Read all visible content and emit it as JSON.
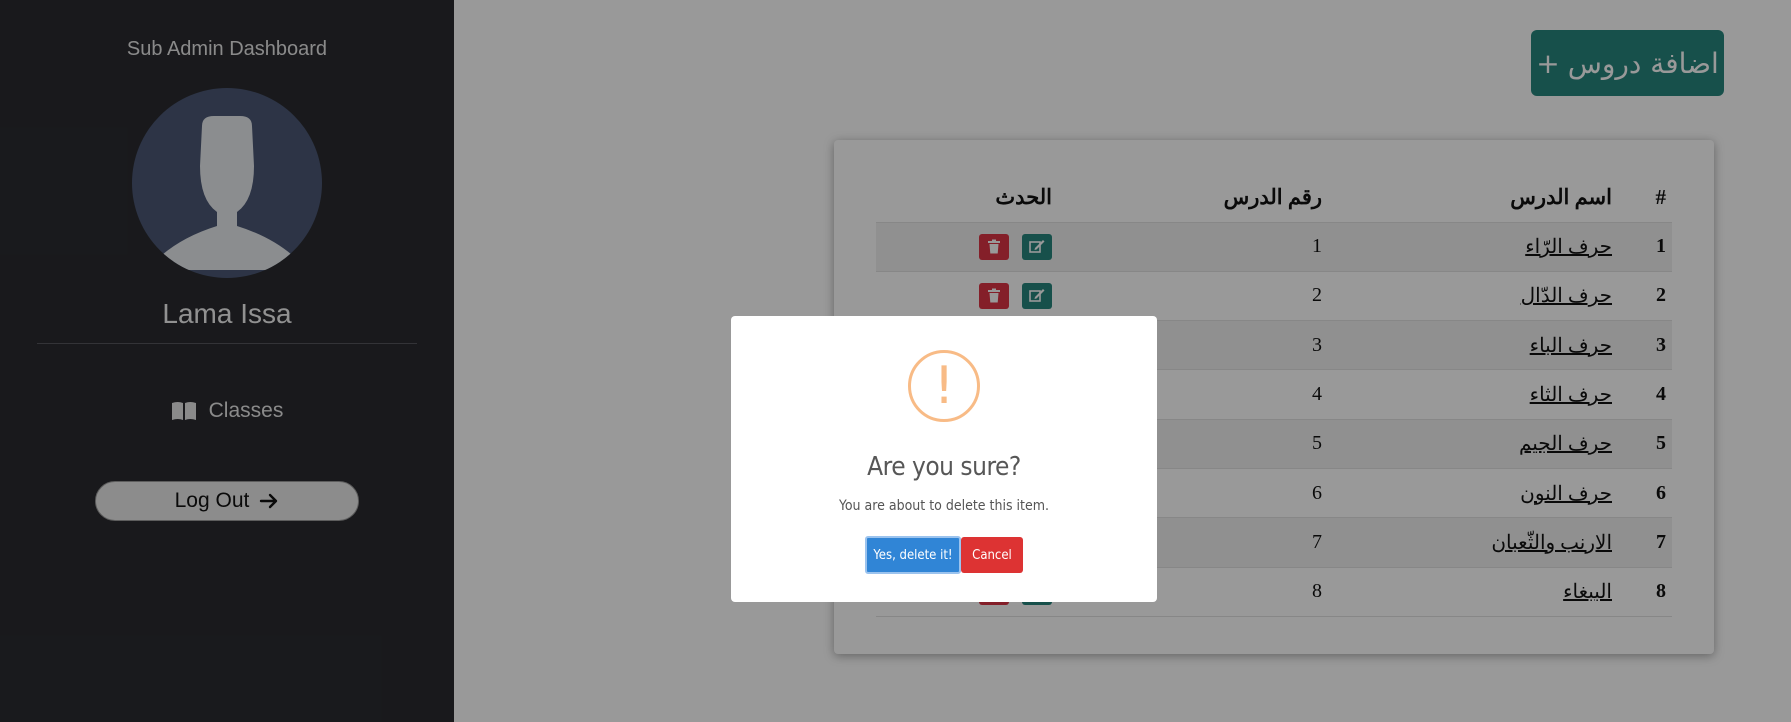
{
  "sidebar": {
    "title": "Sub Admin Dashboard",
    "user_name": "Lama Issa",
    "nav": [
      {
        "label": "Classes",
        "icon": "book-icon"
      }
    ],
    "logout_label": "Log Out"
  },
  "main": {
    "add_button_label": "اضافة دروس",
    "table": {
      "headers": [
        "#",
        "اسم الدرس",
        "رقم الدرس",
        "الحدث"
      ],
      "rows": [
        {
          "num": "1",
          "name": "حرف الرّاء",
          "lesson": "1"
        },
        {
          "num": "2",
          "name": "حرف الدّال",
          "lesson": "2"
        },
        {
          "num": "3",
          "name": "حرف الباء",
          "lesson": "3"
        },
        {
          "num": "4",
          "name": "حرف الثاء",
          "lesson": "4"
        },
        {
          "num": "5",
          "name": "حرف الجيم",
          "lesson": "5"
        },
        {
          "num": "6",
          "name": "حرف النون",
          "lesson": "6"
        },
        {
          "num": "7",
          "name": "الارنب والثّعبان",
          "lesson": "7"
        },
        {
          "num": "8",
          "name": "الببغاء",
          "lesson": "8"
        }
      ]
    }
  },
  "modal": {
    "icon": "warning-icon",
    "icon_glyph": "!",
    "title": "Are you sure?",
    "text": "You are about to delete this item.",
    "confirm_label": "Yes, delete it!",
    "cancel_label": "Cancel"
  },
  "colors": {
    "sidebar_bg": "#2a2b30",
    "accent_teal": "#27867d",
    "danger_red": "#dc3545",
    "confirm_blue": "#3085d6",
    "warning_orange": "#f8bb86"
  }
}
